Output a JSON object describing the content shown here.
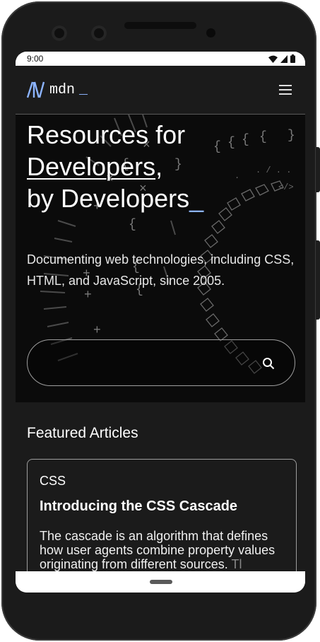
{
  "status_bar": {
    "time": "9:00"
  },
  "header": {
    "logo_text": "mdn",
    "logo_underscore": "_",
    "menu_icon": "hamburger-menu-icon"
  },
  "hero": {
    "title_line1": "Resources for",
    "title_line2": "Developers",
    "title_line2_suffix": ",",
    "title_line3": "by Developers",
    "title_caret": "_",
    "description": "Documenting web technologies, including CSS, HTML, and JavaScript, since 2005.",
    "search_placeholder": "",
    "search_icon": "search-icon"
  },
  "featured": {
    "heading": "Featured Articles",
    "articles": [
      {
        "tag": "CSS",
        "title": "Introducing the CSS Cascade",
        "excerpt": "The cascade is an algorithm that defines how user agents combine property values originating from different sources.",
        "excerpt_fade": "Tl"
      }
    ]
  },
  "colors": {
    "background": "#1b1b1b",
    "hero_background": "#0b0b0b",
    "accent": "#8cb4ff",
    "text": "#ffffff"
  }
}
